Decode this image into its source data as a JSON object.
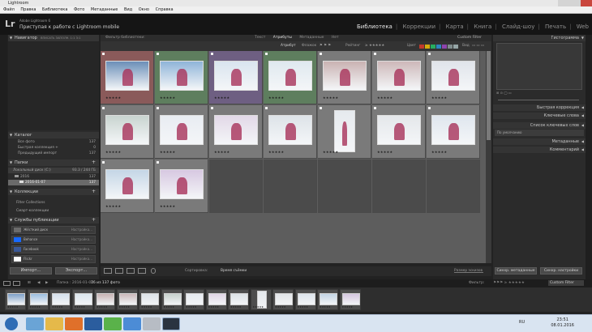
{
  "window": {
    "title": "Lightroom"
  },
  "menu": [
    "Файл",
    "Правка",
    "Библиотека",
    "Фото",
    "Метаданные",
    "Вид",
    "Окно",
    "Справка"
  ],
  "identity": {
    "logo": "Lr",
    "product": "Adobe Lightroom 6",
    "tagline": "Приступая к работе с Lightroom mobile"
  },
  "modules": [
    "Библиотека",
    "Коррекции",
    "Карта",
    "Книга",
    "Слайд-шоу",
    "Печать",
    "Web"
  ],
  "left_panel": {
    "navigator": "Навигатор",
    "navigator_modes": [
      "ВПИСАТЬ",
      "ЗАПОЛН.",
      "1:1",
      "3:1"
    ],
    "catalog": {
      "title": "Каталог",
      "items": [
        {
          "label": "Все фото",
          "count": "137"
        },
        {
          "label": "Быстрая коллекция +",
          "count": "0"
        },
        {
          "label": "Предыдущий импорт",
          "count": "137"
        }
      ]
    },
    "folders": {
      "title": "Папки",
      "volume": {
        "label": "Локальный диск (C:)",
        "space": "93.3 / 244 ГБ"
      },
      "year": {
        "label": "2016",
        "count": "137"
      },
      "folder": {
        "label": "2016-01-07",
        "count": "137"
      }
    },
    "collections": {
      "title": "Коллекции",
      "items": [
        "Filter Collections",
        "Смарт-коллекции"
      ]
    },
    "publish": {
      "title": "Службы публикации",
      "services": [
        {
          "label": "Жёсткий диск",
          "action": "Настройка...",
          "color": "#6b6b6b"
        },
        {
          "label": "Behance",
          "action": "Настройка...",
          "color": "#1769ff"
        },
        {
          "label": "Facebook",
          "action": "Настройка...",
          "color": "#3b5998"
        },
        {
          "label": "Flickr",
          "action": "Настройка...",
          "color": "#ff0084"
        }
      ]
    },
    "import_button": "Импорт...",
    "export_button": "Экспорт..."
  },
  "filter_bar": {
    "label": "Фильтр библиотеки:",
    "tabs": [
      "Текст",
      "Атрибуты",
      "Метаданные",
      "Нет"
    ],
    "active_tab": "Атрибуты",
    "preset": "Custom Filter"
  },
  "attribute_bar": {
    "attribute": "Атрибут",
    "flag": "Флажок",
    "rating": "Рейтинг",
    "color": "Цвет",
    "kind": "Вид",
    "swatches": [
      "#c0392b",
      "#d4ac0d",
      "#27ae60",
      "#2e86c1",
      "#8e44ad",
      "#7f8c8d",
      "#95a5a6"
    ]
  },
  "grid": {
    "cells": [
      {
        "label": "rejected-red",
        "color": "#8a5a5a",
        "photo": "#6b8fb8",
        "stars": "★★★★★"
      },
      {
        "label": "green",
        "color": "#5e7e5e",
        "photo": "#8fb4d8",
        "stars": "★★★★★"
      },
      {
        "label": "purple",
        "color": "#6e5f82",
        "photo": "#d9e4ef",
        "stars": "★★★★★"
      },
      {
        "label": "green",
        "color": "#5e7e5e",
        "photo": "#dfe8ef",
        "stars": "★★★★★"
      },
      {
        "label": "none",
        "color": "#7a7a7a",
        "photo": "#c9b2b2",
        "stars": "★★★★★"
      },
      {
        "label": "none",
        "color": "#7a7a7a",
        "photo": "#cdb8b9",
        "stars": "★★★★★"
      },
      {
        "label": "none",
        "color": "#7a7a7a",
        "photo": "#e0e4ea",
        "stars": "★★★★★"
      },
      {
        "label": "none",
        "color": "#7a7a7a",
        "photo": "#c8d3cf",
        "stars": "★★★★★"
      },
      {
        "label": "none",
        "color": "#7a7a7a",
        "photo": "#e8ecf2",
        "stars": "★★★★★"
      },
      {
        "label": "none",
        "color": "#7a7a7a",
        "photo": "#e2d8e7",
        "stars": "★★★★★"
      },
      {
        "label": "none",
        "color": "#7a7a7a",
        "photo": "#dde3e8",
        "stars": "★★★★★"
      },
      {
        "label": "none",
        "color": "#7a7a7a",
        "photo": "#e6eaee",
        "tall": true,
        "stars": "★★★★★"
      },
      {
        "label": "none",
        "color": "#7a7a7a",
        "photo": "#e4e7ea",
        "stars": "★★★★★"
      },
      {
        "label": "none",
        "color": "#7a7a7a",
        "photo": "#dfe6ee",
        "stars": "★★★★★"
      },
      {
        "label": "none",
        "color": "#7a7a7a",
        "photo": "#c4d6e6",
        "stars": "★★★★★"
      },
      {
        "label": "none",
        "color": "#7a7a7a",
        "photo": "#d7c8e1",
        "stars": "★★★★★"
      }
    ]
  },
  "toolbar": {
    "sort_label": "Сортировка:",
    "sort_value": "Время съёмки",
    "size_label": "Размер эскизов"
  },
  "right_panel": {
    "histogram": "Гистограмма",
    "sections": [
      "Быстрая коррекция",
      "Ключевые слова",
      "Список ключевых слов",
      "Метаданные",
      "Комментарий"
    ],
    "preset_value": "По умолчанию",
    "sync_meta": "Синхр. метаданные",
    "sync_settings": "Синхр. настройки"
  },
  "filmstrip_bar": {
    "pages": [
      "1",
      "2"
    ],
    "path_label": "Папка : 2016-01-07",
    "selection": "16 из 137 фото",
    "filter_label": "Фильтр:",
    "filter_value": "Custom Filter"
  },
  "filmstrip": {
    "items": [
      "#7da0c8",
      "#9bbde0",
      "#d5e0ec",
      "#dbe6ee",
      "#c7b2b3",
      "#cbb7b9",
      "#dde2e8",
      "#c5d0cc",
      "#e6eaf0",
      "#dfd5e5",
      "#dbe1e6",
      "#e4e8ec",
      "#e2e5e8",
      "#dde4ec",
      "#c2d4e4",
      "#d5c6df"
    ]
  },
  "taskbar": {
    "lang": "RU",
    "time": "23:51",
    "date": "08.01.2016"
  }
}
